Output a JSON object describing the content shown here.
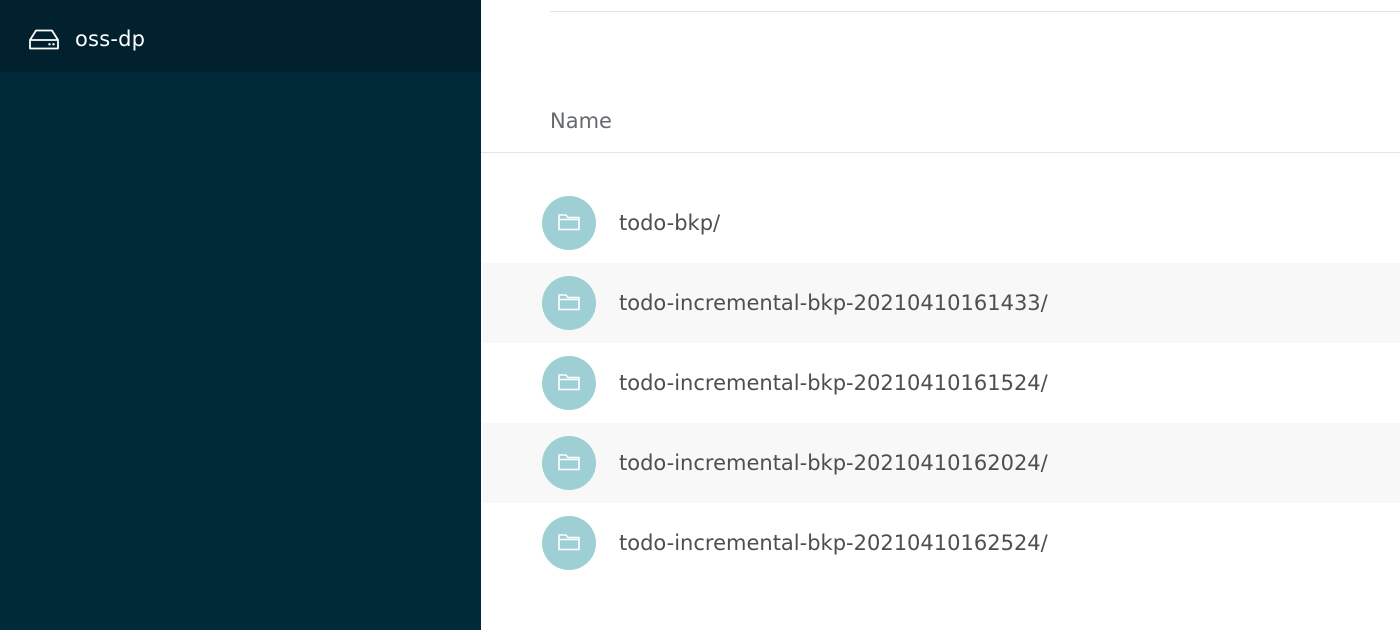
{
  "sidebar": {
    "bucket": {
      "label": "oss-dp",
      "icon": "hard-drive-icon"
    },
    "background": "#002a38",
    "active_background": "#00212d"
  },
  "main": {
    "columns": {
      "name": "Name"
    },
    "items": [
      {
        "label": "todo-bkp/",
        "icon": "folder-icon"
      },
      {
        "label": "todo-incremental-bkp-20210410161433/",
        "icon": "folder-icon"
      },
      {
        "label": "todo-incremental-bkp-20210410161524/",
        "icon": "folder-icon"
      },
      {
        "label": "todo-incremental-bkp-20210410162024/",
        "icon": "folder-icon"
      },
      {
        "label": "todo-incremental-bkp-20210410162524/",
        "icon": "folder-icon"
      }
    ],
    "folder_icon_color": "#9ecfd5",
    "alt_row_color": "#f8f8f8"
  }
}
